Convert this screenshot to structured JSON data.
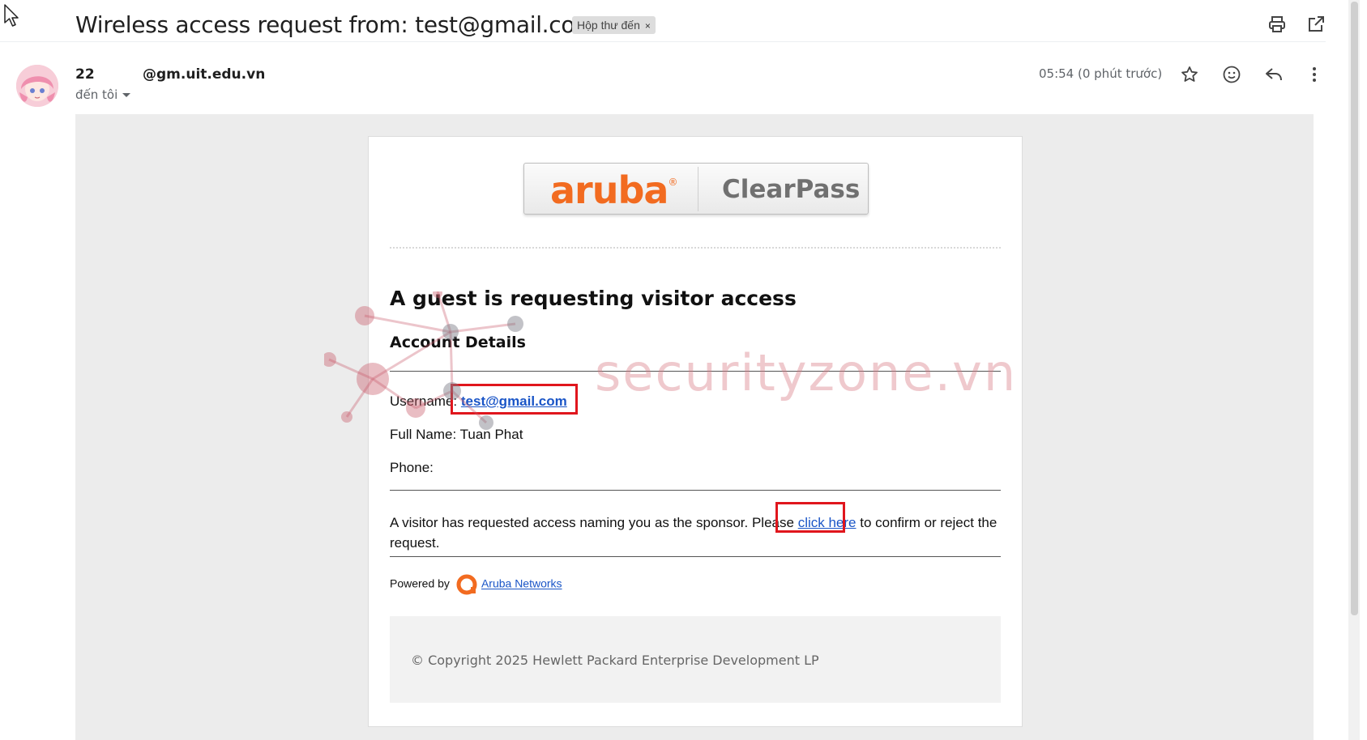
{
  "email": {
    "subject": "Wireless access request from: test@gmail.com",
    "label_chip": "Hộp thư đến",
    "label_remove": "×",
    "sender_prefix": "22",
    "sender_email": "@gm.uit.edu.vn",
    "to": "đến tôi",
    "timestamp": "05:54 (0 phút trước)",
    "icons": [
      "print-icon",
      "open-in-new-window-icon",
      "star-icon",
      "emoji-icon",
      "reply-icon",
      "more-options-icon"
    ]
  },
  "body": {
    "logo_brand": "aruba",
    "logo_brand_mark": "®",
    "logo_product": "ClearPass",
    "heading": "A guest is requesting visitor access",
    "section_title": "Account Details",
    "username_label": "Username:",
    "username_value": "test@gmail.com",
    "fullname_label": "Full Name:",
    "fullname_value": "Tuan Phat",
    "phone_label": "Phone:",
    "phone_value": "",
    "message_before": "A visitor has requested access naming you as the sponsor. Please ",
    "message_link": "click here",
    "message_after": " to confirm or reject the request.",
    "powered_by": "Powered by",
    "powered_link": "Aruba Networks",
    "copyright": "© Copyright 2025 Hewlett Packard Enterprise Development LP"
  },
  "watermark": "securityzone.vn",
  "colors": {
    "aruba_orange": "#f26b20",
    "link_blue": "#1a55c7",
    "highlight_red": "#e0161d"
  }
}
